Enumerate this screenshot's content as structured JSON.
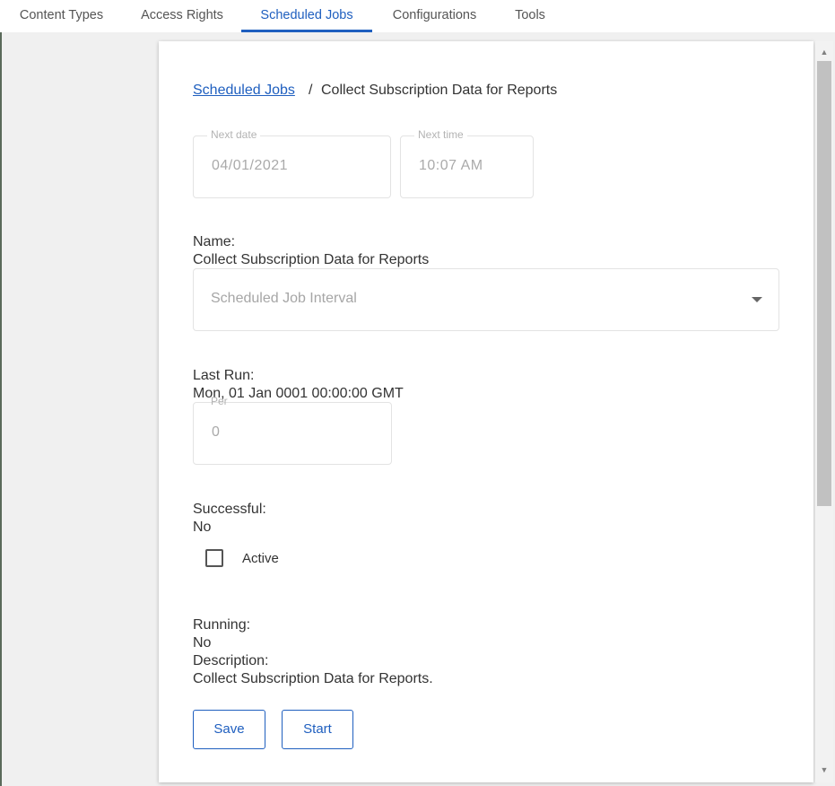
{
  "nav": {
    "tabs": [
      {
        "label": "Content Types"
      },
      {
        "label": "Access Rights"
      },
      {
        "label": "Scheduled Jobs",
        "active": true
      },
      {
        "label": "Configurations"
      },
      {
        "label": "Tools"
      }
    ]
  },
  "breadcrumb": {
    "parent": "Scheduled Jobs",
    "separator": "/",
    "current": "Collect Subscription Data for Reports"
  },
  "form": {
    "next_date": {
      "label": "Next date",
      "value": "04/01/2021"
    },
    "next_time": {
      "label": "Next time",
      "value": "10:07 AM"
    },
    "name_label": "Name:",
    "name_value": "Collect Subscription Data for Reports",
    "interval": {
      "placeholder": "Scheduled Job Interval"
    },
    "last_run_label": "Last Run:",
    "last_run_value": "Mon, 01 Jan 0001 00:00:00 GMT",
    "per": {
      "label": "Per",
      "value": "0"
    },
    "successful_label": "Successful:",
    "successful_value": "No",
    "active": {
      "label": "Active",
      "checked": false
    },
    "running_label": "Running:",
    "running_value": "No",
    "description_label": "Description:",
    "description_value": "Collect Subscription Data for Reports."
  },
  "actions": {
    "save_label": "Save",
    "start_label": "Start"
  },
  "colors": {
    "accent": "#1f5fbf",
    "text": "#333333",
    "muted": "#aaaaaa",
    "border": "#e3e3e3"
  },
  "icons": {
    "dropdown": "caret-down-icon",
    "scroll_up": "scroll-up-arrow-icon",
    "scroll_down": "scroll-down-arrow-icon"
  }
}
